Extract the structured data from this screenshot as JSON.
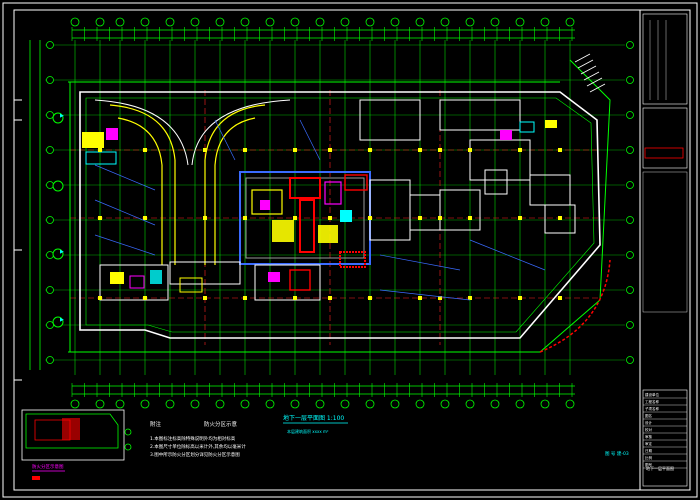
{
  "colors": {
    "background": "#000000",
    "frame": "#ffffff",
    "axis_grid": "#00ff00",
    "axis_red": "#ff2020",
    "wall_white": "#ffffff",
    "room_blue": "#3a6bff",
    "yellow": "#ffff00",
    "magenta": "#ff00ff",
    "cyan": "#00ffff",
    "red": "#ff0000"
  },
  "drawing": {
    "plan_title": "地下一层平面图 1:100",
    "plan_subtitle": "本层建筑面积 xxxx m²",
    "notes_heading": "附注",
    "notes_heading_2": "防火分区示意",
    "notes": [
      "1.本图标注标高除特殊说明外均为相对标高",
      "2.本图尺寸单位除标高以米计外,其余均以毫米计",
      "3.图中所示防火分区划分详见防火分区示意图"
    ],
    "keyplan_label": "防火分区示意图",
    "bottom_right_label": "图 号 建-03"
  },
  "title_block": {
    "rows": [
      "建设单位",
      "工程名称",
      "子项名称",
      "图名",
      "设计",
      "校对",
      "审核",
      "审定",
      "日期",
      "比例",
      "图号"
    ],
    "drawing_name": "地下一层平面图"
  },
  "grid": {
    "vertical_axes": [
      75,
      100,
      120,
      145,
      170,
      195,
      220,
      245,
      270,
      295,
      320,
      345,
      370,
      395,
      420,
      445,
      470,
      495,
      520,
      545,
      570
    ],
    "horizontal_axes": [
      45,
      80,
      115,
      150,
      185,
      220,
      255,
      290,
      325,
      360
    ]
  }
}
